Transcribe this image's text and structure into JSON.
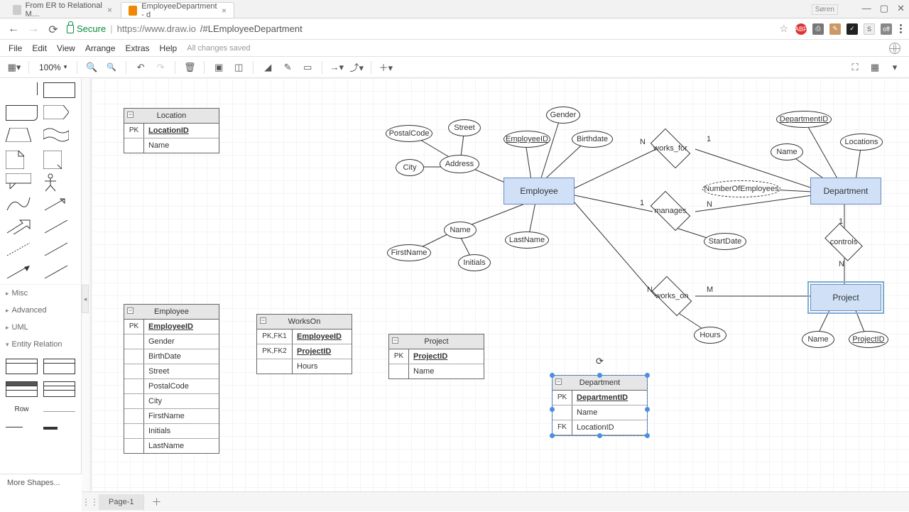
{
  "browser": {
    "user": "Søren",
    "tabs": [
      {
        "title": "From ER to Relational M…",
        "active": false
      },
      {
        "title": "EmployeeDepartment - d",
        "active": true
      }
    ],
    "secure_label": "Secure",
    "url_host": "https://www.draw.io",
    "url_path": "/#LEmployeeDepartment"
  },
  "menu": {
    "items": [
      "File",
      "Edit",
      "View",
      "Arrange",
      "Extras",
      "Help"
    ],
    "status": "All changes saved"
  },
  "toolbar": {
    "zoom": "100%"
  },
  "sidebar": {
    "categories": [
      "Misc",
      "Advanced",
      "UML",
      "Entity Relation"
    ],
    "row_label": "Row",
    "more": "More Shapes..."
  },
  "tables": {
    "location": {
      "title": "Location",
      "rows": [
        {
          "key": "PK",
          "val": "LocationID",
          "pk": true
        },
        {
          "key": "",
          "val": "Name"
        }
      ]
    },
    "employee": {
      "title": "Employee",
      "rows": [
        {
          "key": "PK",
          "val": "EmployeeID",
          "pk": true
        },
        {
          "key": "",
          "val": "Gender"
        },
        {
          "key": "",
          "val": "BirthDate"
        },
        {
          "key": "",
          "val": "Street"
        },
        {
          "key": "",
          "val": "PostalCode"
        },
        {
          "key": "",
          "val": "City"
        },
        {
          "key": "",
          "val": "FirstName"
        },
        {
          "key": "",
          "val": "Initials"
        },
        {
          "key": "",
          "val": "LastName"
        }
      ]
    },
    "workson": {
      "title": "WorksOn",
      "rows": [
        {
          "key": "PK,FK1",
          "val": "EmployeeID",
          "pk": true
        },
        {
          "key": "PK,FK2",
          "val": "ProjectID",
          "pk": true
        },
        {
          "key": "",
          "val": "Hours"
        }
      ]
    },
    "project": {
      "title": "Project",
      "rows": [
        {
          "key": "PK",
          "val": "ProjectID",
          "pk": true
        },
        {
          "key": "",
          "val": "Name"
        }
      ]
    },
    "department": {
      "title": "Department",
      "rows": [
        {
          "key": "PK",
          "val": "DepartmentID",
          "pk": true
        },
        {
          "key": "",
          "val": "Name"
        },
        {
          "key": "FK",
          "val": "LocationID"
        }
      ]
    }
  },
  "er": {
    "entities": {
      "employee": "Employee",
      "department": "Department",
      "project": "Project"
    },
    "attrs": {
      "gender": "Gender",
      "birthdate": "Birthdate",
      "employeeid": "EmployeeID",
      "postalcode": "PostalCode",
      "street": "Street",
      "city": "City",
      "address": "Address",
      "name_emp": "Name",
      "firstname": "FirstName",
      "lastname": "LastName",
      "initials": "Initials",
      "numemp": "NumberOfEmployees",
      "startdate": "StartDate",
      "dept_id": "DepartmentID",
      "dept_name": "Name",
      "dept_loc": "Locations",
      "hours": "Hours",
      "proj_name": "Name",
      "proj_id": "ProjectID"
    },
    "rels": {
      "works_for": "works_for",
      "manages": "manages",
      "works_on": "works_on",
      "controls": "controls"
    },
    "cards": {
      "wf_n": "N",
      "wf_1": "1",
      "mg_1": "1",
      "mg_n": "N",
      "wo_n": "N",
      "wo_m": "M",
      "ct_1": "1",
      "ct_n": "N"
    }
  },
  "pages": {
    "p1": "Page-1"
  }
}
